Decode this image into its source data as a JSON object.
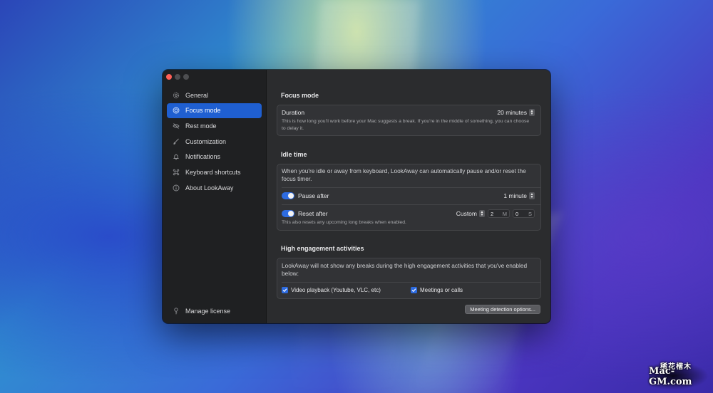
{
  "window": {
    "traffic_lights": [
      "close",
      "minimize",
      "zoom"
    ]
  },
  "sidebar": {
    "items": [
      {
        "label": "General",
        "icon": "gear-icon"
      },
      {
        "label": "Focus mode",
        "icon": "target-icon",
        "active": true
      },
      {
        "label": "Rest mode",
        "icon": "eye-slash-icon"
      },
      {
        "label": "Customization",
        "icon": "paintbrush-icon"
      },
      {
        "label": "Notifications",
        "icon": "bell-icon"
      },
      {
        "label": "Keyboard shortcuts",
        "icon": "command-icon"
      },
      {
        "label": "About LookAway",
        "icon": "info-icon"
      }
    ],
    "footer": {
      "label": "Manage license",
      "icon": "key-icon"
    }
  },
  "focus_mode": {
    "title": "Focus mode",
    "duration_label": "Duration",
    "duration_value": "20 minutes",
    "duration_desc": "This is how long you'll work before your Mac suggests a break. If you're in the middle of something, you can choose to delay it."
  },
  "idle_time": {
    "title": "Idle time",
    "intro": "When you're idle or away from keyboard, LookAway can automatically pause and/or reset the focus timer.",
    "pause_label": "Pause after",
    "pause_value": "1 minute",
    "reset_label": "Reset after",
    "reset_mode": "Custom",
    "reset_minutes": "2",
    "reset_minutes_unit": "M",
    "reset_seconds": "0",
    "reset_seconds_unit": "S",
    "reset_desc": "This also resets any upcoming long breaks when enabled."
  },
  "high_engagement": {
    "title": "High engagement activities",
    "intro": "LookAway will not show any breaks during the high engagement activities that you've enabled below:",
    "option_video": "Video playback (Youtube, VLC, etc)",
    "option_meetings": "Meetings or calls",
    "button_label": "Meeting detection options..."
  },
  "watermark": {
    "top_text": "稀花楷木",
    "bottom_text": "Mac-GM.com"
  },
  "colors": {
    "accent": "#1f5fd1",
    "sidebar_bg": "#1f2022",
    "content_bg": "#2b2c2e",
    "close": "#ff5f57"
  }
}
